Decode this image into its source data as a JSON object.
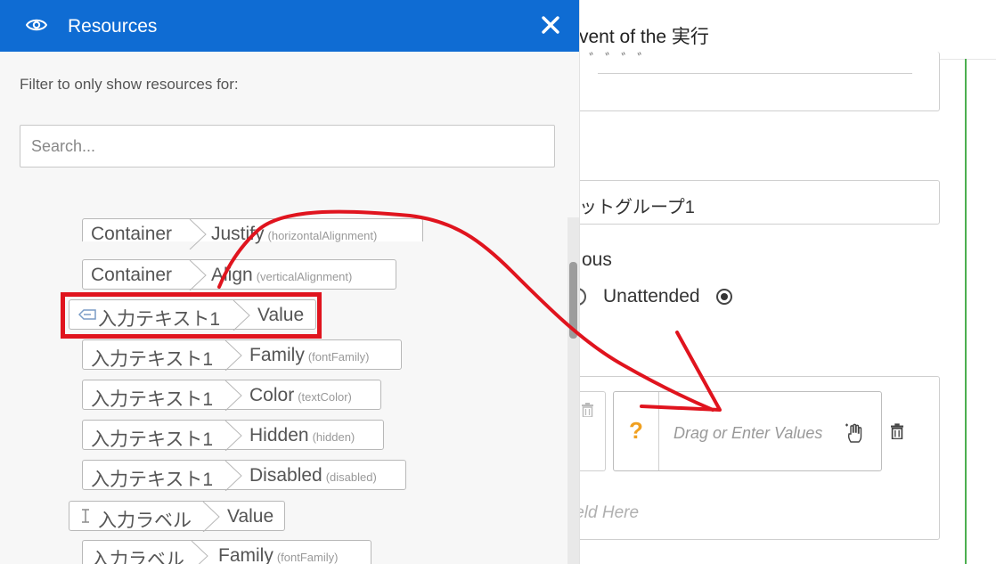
{
  "background_app": {
    "header_title": "vent of the 実行",
    "top_field_fragment": "ﾞ ﾞ ﾞ ﾞ",
    "group_field_value": "ットグループ1",
    "mode_label_fragment": "ous",
    "radio_unattended_label": "Unattended",
    "value_card": {
      "question_mark": "?",
      "placeholder": "Drag or Enter Values"
    },
    "drop_hint": "ield Here"
  },
  "resources_panel": {
    "title": "Resources",
    "filter_label": "Filter to only show resources for:",
    "search_placeholder": "Search...",
    "items": [
      {
        "parts": [
          "Container",
          "Justify"
        ],
        "hint": "(horizontalAlignment)"
      },
      {
        "parts": [
          "Container",
          "Align"
        ],
        "hint": "(verticalAlignment)"
      },
      {
        "parts": [
          "入力テキスト1",
          "Value"
        ],
        "hint": ""
      },
      {
        "parts": [
          "入力テキスト1",
          "Family"
        ],
        "hint": "(fontFamily)"
      },
      {
        "parts": [
          "入力テキスト1",
          "Color"
        ],
        "hint": "(textColor)"
      },
      {
        "parts": [
          "入力テキスト1",
          "Hidden"
        ],
        "hint": "(hidden)"
      },
      {
        "parts": [
          "入力テキスト1",
          "Disabled"
        ],
        "hint": "(disabled)"
      },
      {
        "parts": [
          "入力ラベル",
          "Value"
        ],
        "hint": ""
      },
      {
        "parts": [
          "入力ラベル",
          "Family"
        ],
        "hint": "(fontFamily)"
      }
    ]
  },
  "colors": {
    "header_blue": "#0f6cd3",
    "annotation_red": "#e0141e",
    "accent_orange": "#f0a020",
    "status_green": "#4caf50"
  }
}
